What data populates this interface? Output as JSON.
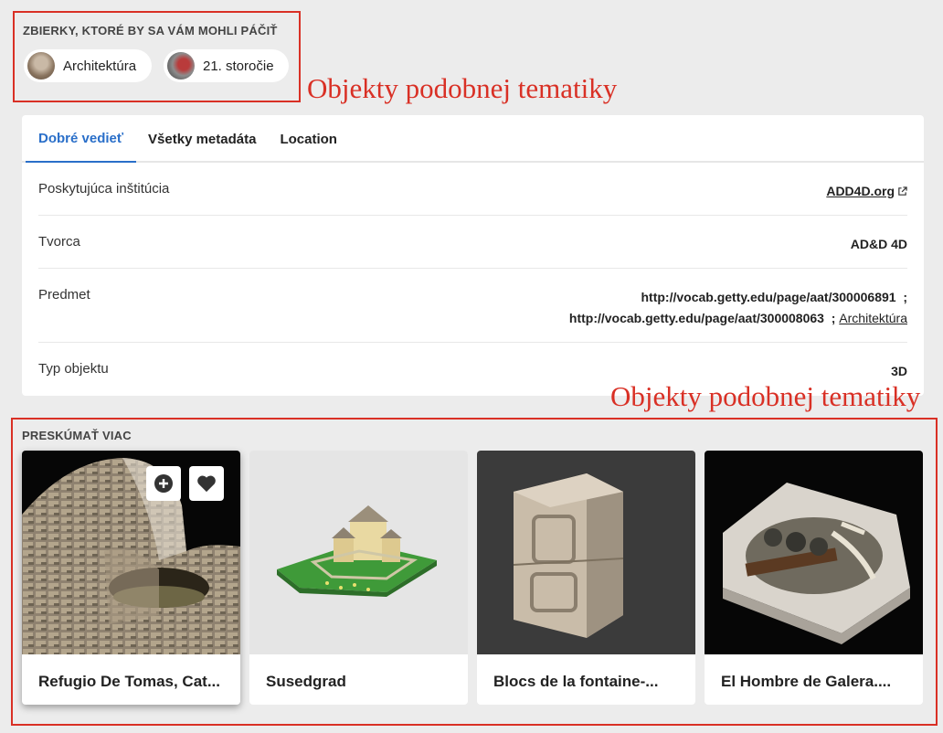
{
  "collections": {
    "title": "ZBIERKY, KTORÉ BY SA VÁM MOHLI PÁČIŤ",
    "chips": [
      {
        "label": "Architektúra"
      },
      {
        "label": "21. storočie"
      }
    ]
  },
  "annotations": {
    "top": "Objekty podobnej tematiky",
    "bottom": "Objekty podobnej tematiky",
    "color": "#d93025"
  },
  "tabs": [
    {
      "label": "Dobré vedieť",
      "active": true
    },
    {
      "label": "Všetky metadáta",
      "active": false
    },
    {
      "label": "Location",
      "active": false
    }
  ],
  "details": {
    "institution": {
      "key": "Poskytujúca inštitúcia",
      "value": "ADD4D.org"
    },
    "creator": {
      "key": "Tvorca",
      "value": "AD&D 4D"
    },
    "subject": {
      "key": "Predmet",
      "line1": "http://vocab.getty.edu/page/aat/300006891  ;",
      "line2_prefix": "http://vocab.getty.edu/page/aat/300008063  ;",
      "line2_link": "Architektúra"
    },
    "type": {
      "key": "Typ objektu",
      "value": "3D"
    }
  },
  "explore": {
    "title": "PRESKÚMAŤ VIAC",
    "cards": [
      {
        "title": "Refugio De Tomas, Cat..."
      },
      {
        "title": "Susedgrad"
      },
      {
        "title": "Blocs de la fontaine-..."
      },
      {
        "title": "El Hombre de Galera...."
      }
    ],
    "icons": {
      "add": "plus-circle-icon",
      "favorite": "heart-icon"
    }
  },
  "colors": {
    "accent": "#2a6fc9",
    "background": "#ececec"
  }
}
